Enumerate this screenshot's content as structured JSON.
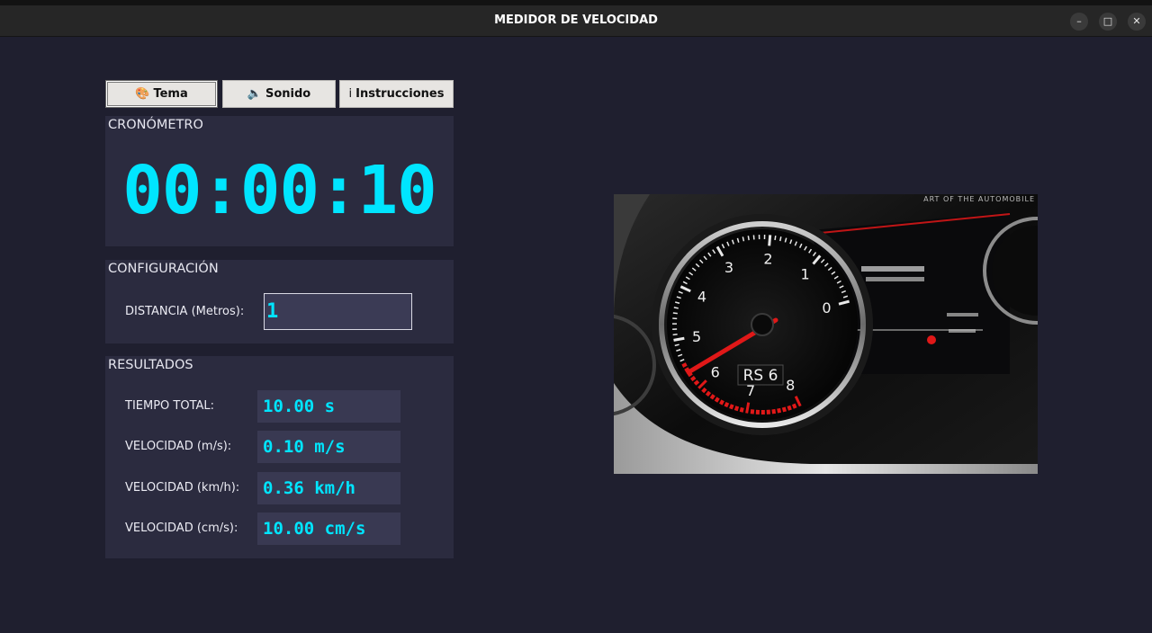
{
  "window": {
    "title": "MEDIDOR DE VELOCIDAD",
    "minimize": "–",
    "maximize": "□",
    "close": "✕"
  },
  "toolbar": {
    "tema": {
      "icon": "🎨",
      "label": "Tema"
    },
    "sonido": {
      "icon": "🔈",
      "label": "Sonido"
    },
    "instrucciones": {
      "icon": "i",
      "label": "Instrucciones"
    }
  },
  "cronometro": {
    "title": "CRONÓMETRO",
    "time": "00:00:10"
  },
  "configuracion": {
    "title": "CONFIGURACIÓN",
    "distance_label": "DISTANCIA (Metros):",
    "distance_value": "1"
  },
  "resultados": {
    "title": "RESULTADOS",
    "rows": [
      {
        "label": "TIEMPO TOTAL:",
        "value": "10.00 s"
      },
      {
        "label": "VELOCIDAD (m/s):",
        "value": "0.10 m/s"
      },
      {
        "label": "VELOCIDAD (km/h):",
        "value": "0.36 km/h"
      },
      {
        "label": "VELOCIDAD (cm/s):",
        "value": "10.00 cm/s"
      }
    ]
  },
  "image": {
    "watermark": "ART OF THE AUTOMOBILE",
    "badge": "RS 6",
    "gauge_numbers": [
      "0",
      "1",
      "2",
      "3",
      "4",
      "5",
      "6",
      "7",
      "8"
    ],
    "accent_red": "#e01818",
    "display_text_line1": "Switch off ignition",
    "display_text_line2": "before leaving car"
  }
}
